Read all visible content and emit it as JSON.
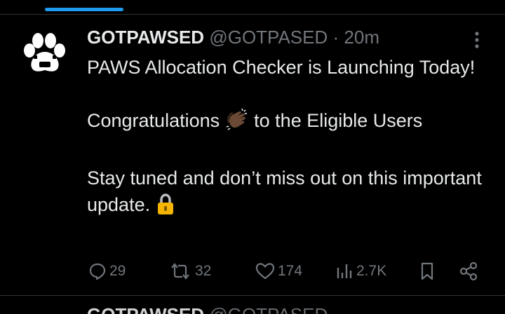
{
  "post": {
    "display_name": "GOTPAWSED",
    "handle": "@GOTPASED",
    "separator": "·",
    "time": "20m",
    "text": {
      "line1": "PAWS Allocation Checker is Launching Today!",
      "line2_before": "Congratulations",
      "line2_after": "to the Eligible Users",
      "line3": "Stay tuned and don’t miss out on this important update."
    },
    "stats": {
      "replies": "29",
      "reposts": "32",
      "likes": "174",
      "views": "2.7K"
    }
  },
  "next_post": {
    "display_name": "GOTPAWSED",
    "handle": "@GOTPASED",
    "separator": "·"
  },
  "icons": {
    "avatar": "paw-icon",
    "more": "more-vertical-icon",
    "emoji1": "clapping-hands-emoji",
    "emoji2": "lock-emoji",
    "actions": [
      "reply-icon",
      "repost-icon",
      "like-icon",
      "views-icon",
      "bookmark-icon",
      "share-icon"
    ]
  },
  "colors": {
    "background": "#000000",
    "text": "#e7e9ea",
    "muted": "#71767b",
    "accent": "#1d9bf0",
    "divider": "#2f3336"
  }
}
